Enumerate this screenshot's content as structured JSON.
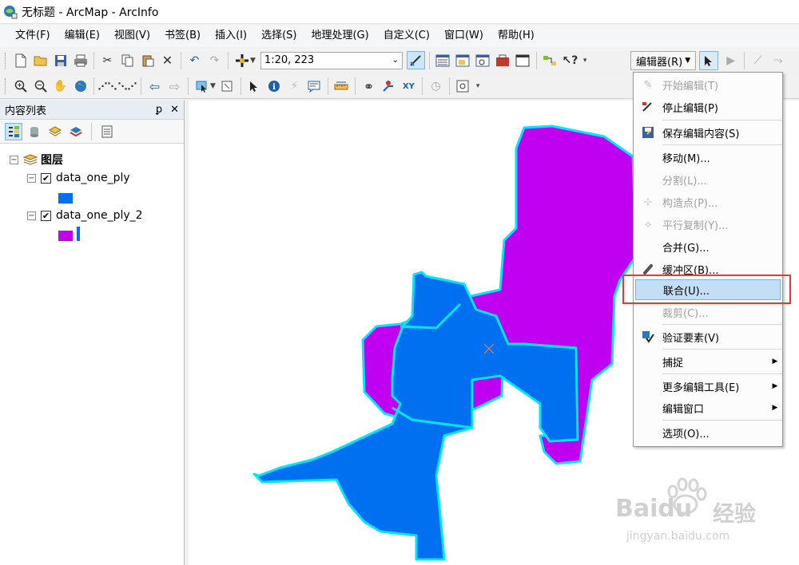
{
  "window": {
    "title": "无标题 - ArcMap - ArcInfo"
  },
  "menubar": {
    "items": [
      "文件(F)",
      "编辑(E)",
      "视图(V)",
      "书签(B)",
      "插入(I)",
      "选择(S)",
      "地理处理(G)",
      "自定义(C)",
      "窗口(W)",
      "帮助(H)"
    ]
  },
  "toolbar": {
    "scale": "1:20, 223"
  },
  "editor_toolbar": {
    "label": "编辑器(R)"
  },
  "toc": {
    "title": "内容列表",
    "root": "图层",
    "layers": [
      {
        "name": "data_one_ply",
        "checked": true,
        "color": "#0070f0"
      },
      {
        "name": "data_one_ply_2",
        "checked": true,
        "color": "#c000f0"
      }
    ]
  },
  "editor_menu": {
    "items": [
      {
        "label": "开始编辑(T)",
        "enabled": false,
        "icon": "pencil-icon"
      },
      {
        "label": "停止编辑(P)",
        "enabled": true,
        "icon": "stop-edit-icon"
      },
      {
        "label": "保存编辑内容(S)",
        "enabled": true,
        "icon": "save-icon"
      },
      {
        "label": "移动(M)...",
        "enabled": true
      },
      {
        "label": "分割(L)...",
        "enabled": false
      },
      {
        "label": "构造点(P)...",
        "enabled": false,
        "icon": "construct-points-icon"
      },
      {
        "label": "平行复制(Y)...",
        "enabled": false,
        "icon": "copy-parallel-icon"
      },
      {
        "label": "合并(G)...",
        "enabled": true
      },
      {
        "label": "缓冲区(B)...",
        "enabled": true,
        "icon": "buffer-icon"
      },
      {
        "label": "联合(U)...",
        "enabled": true,
        "highlighted": true
      },
      {
        "label": "裁剪(C)...",
        "enabled": false
      },
      {
        "label": "验证要素(V)",
        "enabled": true,
        "icon": "validate-icon"
      },
      {
        "label": "捕捉",
        "enabled": true,
        "submenu": true
      },
      {
        "label": "更多编辑工具(E)",
        "enabled": true,
        "submenu": true
      },
      {
        "label": "编辑窗口",
        "enabled": true,
        "submenu": true
      },
      {
        "label": "选项(O)...",
        "enabled": true
      }
    ]
  },
  "map": {
    "colors": {
      "layer1_fill": "#0070f0",
      "layer2_fill": "#c000f0",
      "outline": "#00e5ff"
    }
  },
  "watermark": {
    "brand": "Baidu",
    "cn": "经验",
    "url": "jingyan.baidu.com"
  }
}
